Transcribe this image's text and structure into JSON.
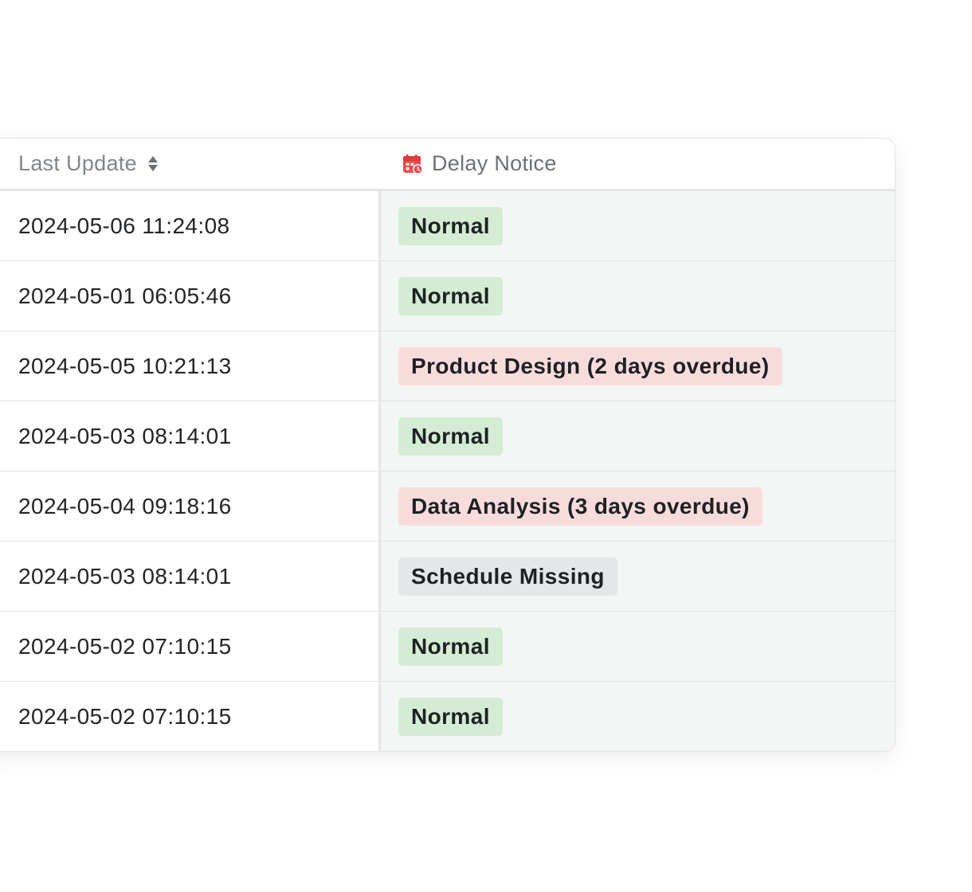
{
  "table": {
    "headers": {
      "last_update": "Last Update",
      "delay_notice": "Delay Notice"
    },
    "header_icons": {
      "sort": "sort-icon",
      "notice": "calendar-clock-icon"
    },
    "status_colors": {
      "normal": "#d3ecd3",
      "overdue": "#f8dcdc",
      "missing": "#e4e6e8",
      "icon_accent": "#ee4b4b"
    },
    "rows": [
      {
        "date": "2024-05-06 11:24:08",
        "notice": "Normal",
        "status": "normal"
      },
      {
        "date": "2024-05-01 06:05:46",
        "notice": "Normal",
        "status": "normal"
      },
      {
        "date": "2024-05-05 10:21:13",
        "notice": "Product Design (2 days overdue)",
        "status": "overdue"
      },
      {
        "date": "2024-05-03 08:14:01",
        "notice": "Normal",
        "status": "normal"
      },
      {
        "date": "2024-05-04 09:18:16",
        "notice": "Data Analysis (3 days overdue)",
        "status": "overdue"
      },
      {
        "date": "2024-05-03 08:14:01",
        "notice": "Schedule Missing",
        "status": "missing"
      },
      {
        "date": "2024-05-02 07:10:15",
        "notice": "Normal",
        "status": "normal"
      },
      {
        "date": "2024-05-02 07:10:15",
        "notice": "Normal",
        "status": "normal"
      }
    ]
  }
}
